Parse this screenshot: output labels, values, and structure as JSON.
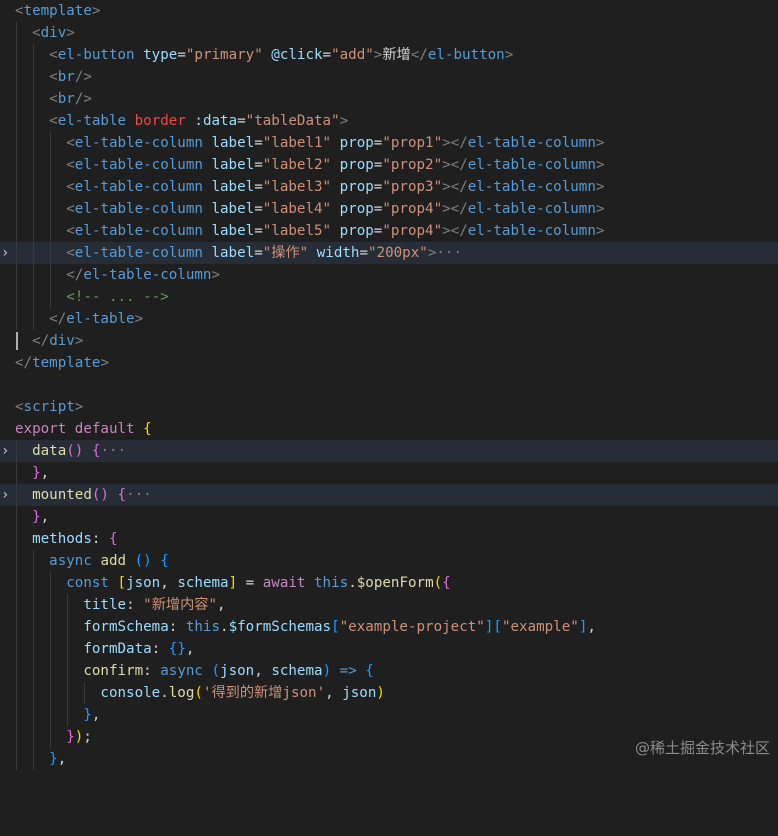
{
  "editor": {
    "language": "vue",
    "lines": [
      "<template>",
      "  <div>",
      "    <el-button type=\"primary\" @click=\"add\">新增</el-button>",
      "    <br/>",
      "    <br/>",
      "    <el-table border :data=\"tableData\">",
      "      <el-table-column label=\"label1\" prop=\"prop1\"></el-table-column>",
      "      <el-table-column label=\"label2\" prop=\"prop2\"></el-table-column>",
      "      <el-table-column label=\"label3\" prop=\"prop3\"></el-table-column>",
      "      <el-table-column label=\"label4\" prop=\"prop4\"></el-table-column>",
      "      <el-table-column label=\"label5\" prop=\"prop4\"></el-table-column>",
      "      <el-table-column label=\"操作\" width=\"200px\">···",
      "      </el-table-column>",
      "      <!-- ... -->",
      "    </el-table>",
      "  </div>",
      "</template>",
      "",
      "<script>",
      "export default {",
      "  data() {···",
      "  },",
      "  mounted() {···",
      "  },",
      "  methods: {",
      "    async add () {",
      "      const [json, schema] = await this.$openForm({",
      "        title: \"新增内容\",",
      "        formSchema: this.$formSchemas[\"example-project\"][\"example\"],",
      "        formData: {},",
      "        confirm: async (json, schema) => {",
      "          console.log('得到的新增json', json)",
      "        },",
      "      });",
      "    },"
    ],
    "folded_markers": {
      "collapsed_icon": "chevron-right-icon"
    }
  },
  "watermark": "@稀土掘金技术社区"
}
